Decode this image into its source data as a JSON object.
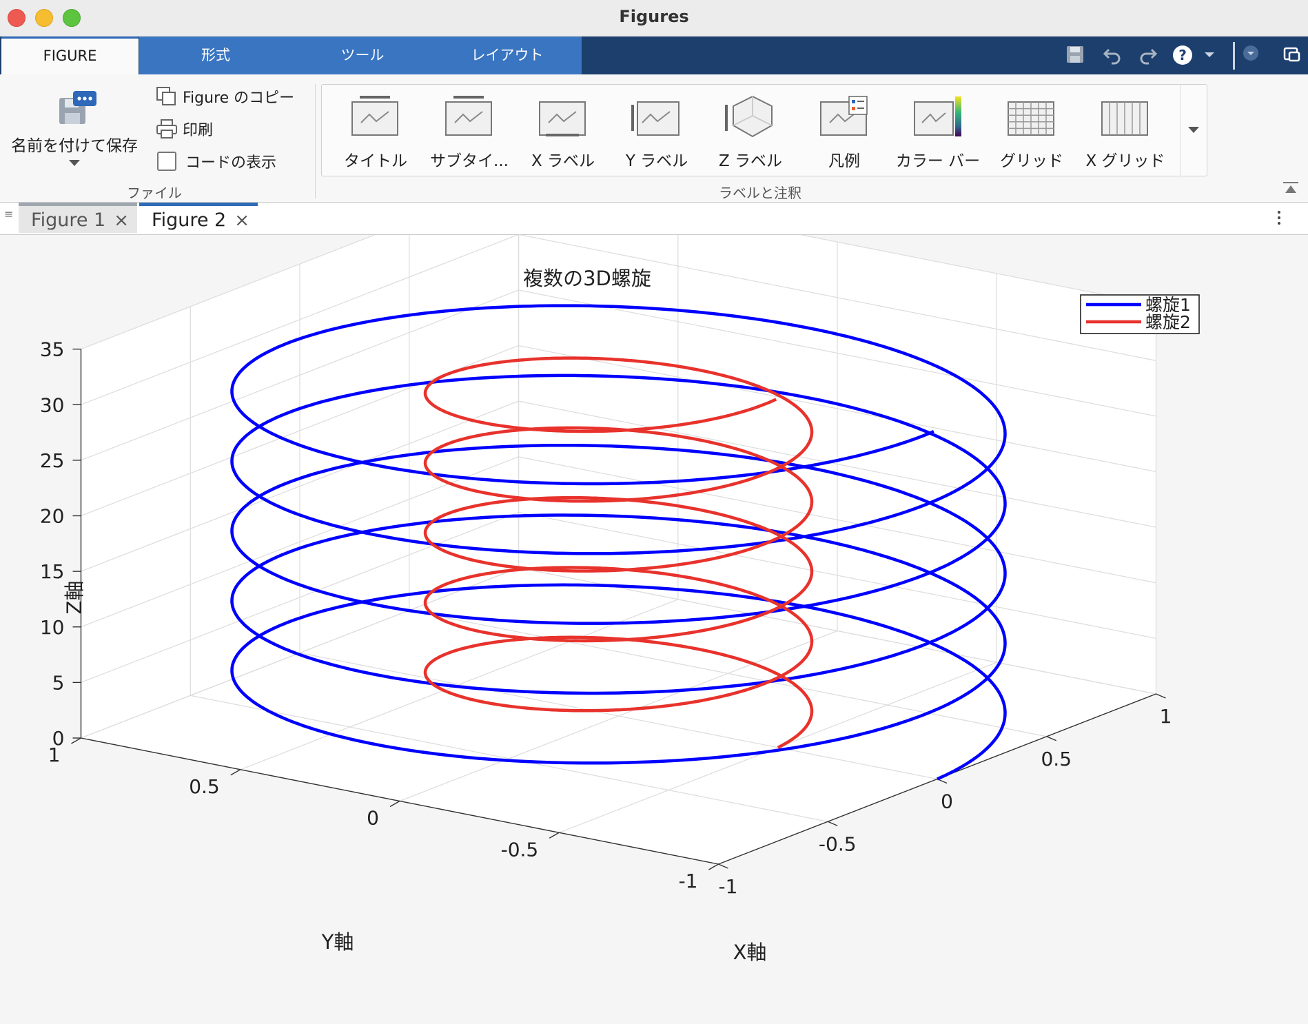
{
  "window": {
    "title": "Figures"
  },
  "ribbon": {
    "tabs": [
      {
        "label": "FIGURE"
      },
      {
        "label": "形式"
      },
      {
        "label": "ツール"
      },
      {
        "label": "レイアウト"
      }
    ],
    "file": {
      "save_as": "名前を付けて保存",
      "copy_figure": "Figure のコピー",
      "print": "印刷",
      "show_code": "コードの表示",
      "section_label": "ファイル"
    },
    "labels": {
      "items": [
        {
          "label": "タイトル",
          "icon": "title-icon"
        },
        {
          "label": "サブタイ...",
          "icon": "subtitle-icon"
        },
        {
          "label": "X ラベル",
          "icon": "xlabel-icon"
        },
        {
          "label": "Y ラベル",
          "icon": "ylabel-icon"
        },
        {
          "label": "Z ラベル",
          "icon": "zlabel-icon"
        },
        {
          "label": "凡例",
          "icon": "legend-icon"
        },
        {
          "label": "カラー バー",
          "icon": "colorbar-icon"
        },
        {
          "label": "グリッド",
          "icon": "grid-icon"
        },
        {
          "label": "X グリッド",
          "icon": "xgrid-icon"
        }
      ],
      "section_label": "ラベルと注釈"
    }
  },
  "doc_tabs": [
    {
      "label": "Figure 1",
      "active": false
    },
    {
      "label": "Figure 2",
      "active": true
    }
  ],
  "chart_data": {
    "type": "line",
    "projection": "3d",
    "title": "複数の3D螺旋",
    "xlabel": "X軸",
    "ylabel": "Y軸",
    "zlabel": "Z軸",
    "xlim": [
      -1,
      1
    ],
    "ylim": [
      -1,
      1
    ],
    "zlim": [
      0,
      35
    ],
    "xticks": [
      "-1",
      "-0.5",
      "0",
      "0.5",
      "1"
    ],
    "yticks": [
      "-1",
      "-0.5",
      "0",
      "0.5",
      "1"
    ],
    "zticks": [
      "0",
      "5",
      "10",
      "15",
      "20",
      "25",
      "30",
      "35"
    ],
    "grid": true,
    "legend": "top-right",
    "series": [
      {
        "name": "螺旋1",
        "color": "#0000ff",
        "x": "cos(t)",
        "y": "sin(t)",
        "z": "t",
        "t_range": [
          0,
          31.4
        ],
        "radius": 1.0
      },
      {
        "name": "螺旋2",
        "color": "#e8322c",
        "x": "0.5*cos(t)",
        "y": "0.5*sin(t)",
        "z": "t",
        "t_range": [
          0,
          31.4
        ],
        "radius": 0.5
      }
    ]
  }
}
